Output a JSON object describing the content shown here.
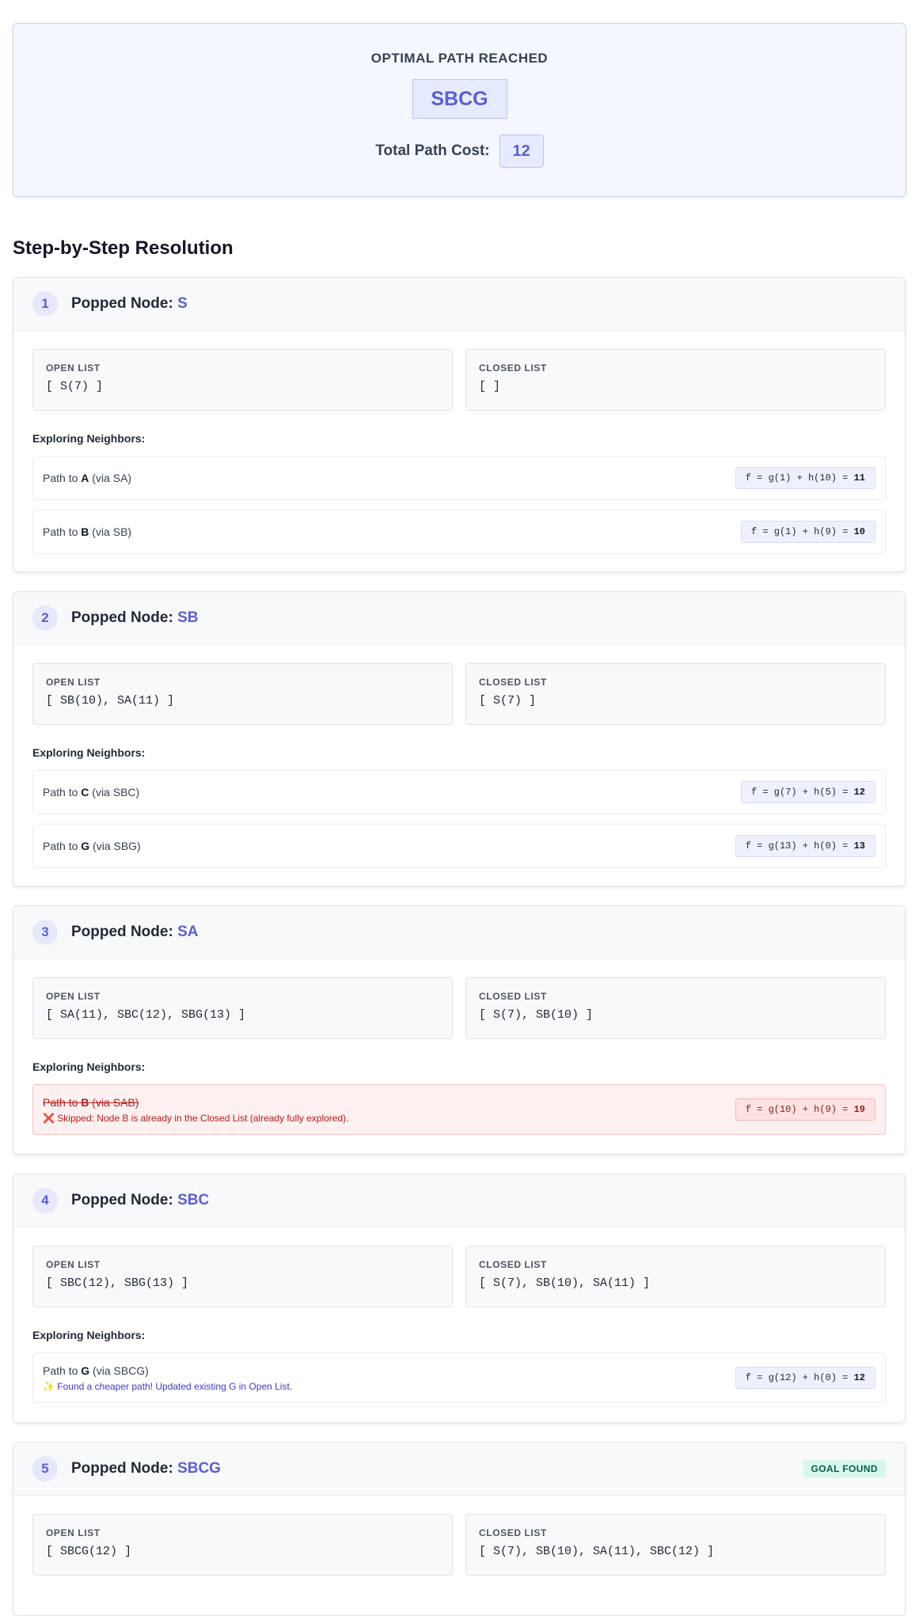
{
  "summary": {
    "title": "OPTIMAL PATH REACHED",
    "path": "SBCG",
    "cost_label": "Total Path Cost:",
    "cost_value": "12"
  },
  "section_heading": "Step-by-Step Resolution",
  "labels": {
    "popped_node": "Popped Node:",
    "open_list": "OPEN LIST",
    "closed_list": "CLOSED LIST",
    "exploring": "Exploring Neighbors:",
    "path_to": "Path to",
    "goal_badge": "GOAL FOUND"
  },
  "steps": [
    {
      "num": "1",
      "node": "S",
      "open": "[ S(7) ]",
      "closed": "[ ]",
      "neighbors": [
        {
          "dest": "A",
          "via": "(via SA)",
          "formula_prefix": "f = g(1) + h(10) = ",
          "f": "11"
        },
        {
          "dest": "B",
          "via": "(via SB)",
          "formula_prefix": "f = g(1) + h(9) = ",
          "f": "10"
        }
      ]
    },
    {
      "num": "2",
      "node": "SB",
      "open": "[ SB(10), SA(11) ]",
      "closed": "[ S(7) ]",
      "neighbors": [
        {
          "dest": "C",
          "via": "(via SBC)",
          "formula_prefix": "f = g(7) + h(5) = ",
          "f": "12"
        },
        {
          "dest": "G",
          "via": "(via SBG)",
          "formula_prefix": "f = g(13) + h(0) = ",
          "f": "13"
        }
      ]
    },
    {
      "num": "3",
      "node": "SA",
      "open": "[ SA(11), SBC(12), SBG(13) ]",
      "closed": "[ S(7), SB(10) ]",
      "neighbors": [
        {
          "dest": "B",
          "via": "(via SAB)",
          "formula_prefix": "f = g(10) + h(9) = ",
          "f": "19",
          "note": "❌ Skipped: Node B is already in the Closed List (already fully explored)."
        }
      ]
    },
    {
      "num": "4",
      "node": "SBC",
      "open": "[ SBC(12), SBG(13) ]",
      "closed": "[ S(7), SB(10), SA(11) ]",
      "neighbors": [
        {
          "dest": "G",
          "via": "(via SBCG)",
          "formula_prefix": "f = g(12) + h(0) = ",
          "f": "12",
          "note": "✨ Found a cheaper path! Updated existing G in Open List."
        }
      ]
    },
    {
      "num": "5",
      "node": "SBCG",
      "open": "[ SBCG(12) ]",
      "closed": "[ S(7), SB(10), SA(11), SBC(12) ]"
    }
  ]
}
